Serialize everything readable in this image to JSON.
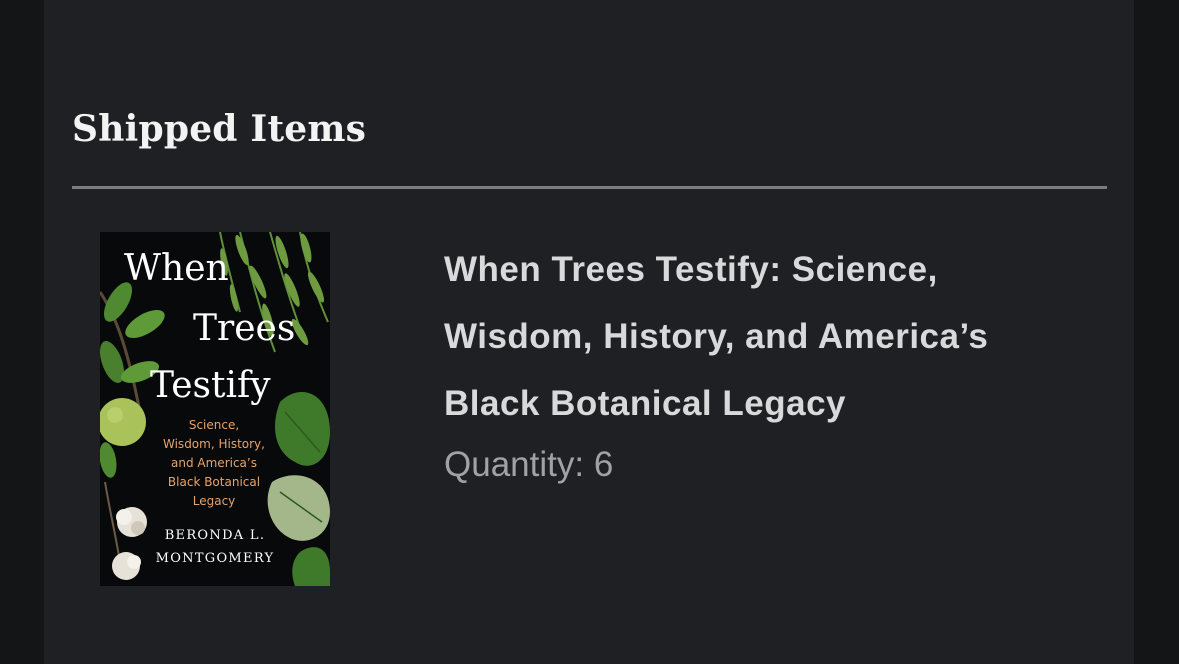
{
  "section": {
    "title": "Shipped Items"
  },
  "item": {
    "title_lines": [
      "When Trees Testify: Science,",
      "Wisdom, History, and America’s",
      "Black Botanical Legacy"
    ],
    "quantity_label": "Quantity:",
    "quantity": 6,
    "cover": {
      "title_lines": [
        "When",
        "Trees",
        "Testify"
      ],
      "subtitle_lines": [
        "Science,",
        "Wisdom, History,",
        "and America’s",
        "Black Botanical",
        "Legacy"
      ],
      "author_lines": [
        "BERONDA L.",
        "MONTGOMERY"
      ],
      "colors": {
        "background": "#08090a",
        "subtitle": "#e7a36c",
        "leaf": "#4f8a32",
        "fruit": "#a9c25a"
      }
    }
  },
  "colors": {
    "page_background": "#141517",
    "card_background": "#1f2023",
    "heading": "#f3f3f3",
    "divider": "#7c7c80",
    "item_title": "#d9d9db",
    "quantity": "#a2a2a6"
  }
}
